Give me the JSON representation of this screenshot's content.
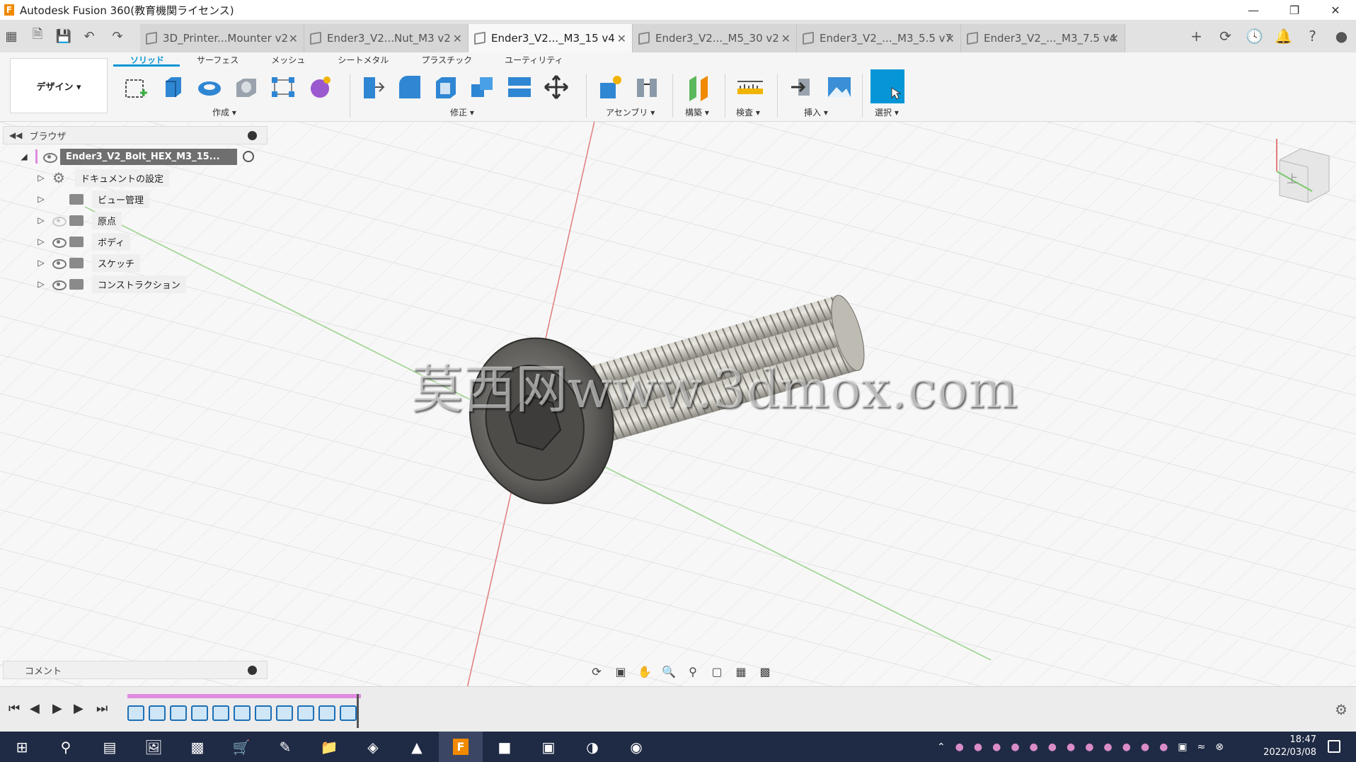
{
  "app": {
    "title": "Autodesk Fusion 360(教育機関ライセンス)",
    "logo_letter": "F"
  },
  "tabs": [
    {
      "label": "3D_Printer...Mounter v2",
      "active": false
    },
    {
      "label": "Ender3_V2...Nut_M3 v2",
      "active": false
    },
    {
      "label": "Ender3_V2..._M3_15 v4",
      "active": true
    },
    {
      "label": "Ender3_V2..._M5_30 v2",
      "active": false
    },
    {
      "label": "Ender3_V2_..._M3_5.5 v7",
      "active": false
    },
    {
      "label": "Ender3_V2_..._M3_7.5 v4",
      "active": false
    }
  ],
  "ribbon": {
    "workspace": "デザイン ▾",
    "tabs": [
      "ソリッド",
      "サーフェス",
      "メッシュ",
      "シートメタル",
      "プラスチック",
      "ユーティリティ"
    ],
    "groups": {
      "create": "作成 ▾",
      "modify": "修正 ▾",
      "assembly": "アセンブリ ▾",
      "construct": "構築 ▾",
      "inspect": "検査 ▾",
      "insert": "挿入 ▾",
      "select": "選択 ▾"
    }
  },
  "browser": {
    "title": "ブラウザ",
    "root": "Ender3_V2_Bolt_HEX_M3_15...",
    "items": [
      {
        "label": "ドキュメントの設定",
        "icon": "gear-icon",
        "eye": false
      },
      {
        "label": "ビュー管理",
        "icon": "folder-icon",
        "eye": false
      },
      {
        "label": "原点",
        "icon": "folder-icon",
        "eye": true,
        "hidden": true
      },
      {
        "label": "ボディ",
        "icon": "folder-icon",
        "eye": true
      },
      {
        "label": "スケッチ",
        "icon": "folder-icon",
        "eye": true
      },
      {
        "label": "コンストラクション",
        "icon": "folder-icon",
        "eye": true
      }
    ]
  },
  "comments": {
    "title": "コメント"
  },
  "viewport": {
    "watermark": "莫西网www.3dmox.com",
    "viewcube_face": "上"
  },
  "taskbar": {
    "time": "18:47",
    "date": "2022/03/08"
  },
  "colors": {
    "accent": "#0696d7",
    "timeline_bar": "#e08be0",
    "taskbar": "#1f2a44"
  }
}
